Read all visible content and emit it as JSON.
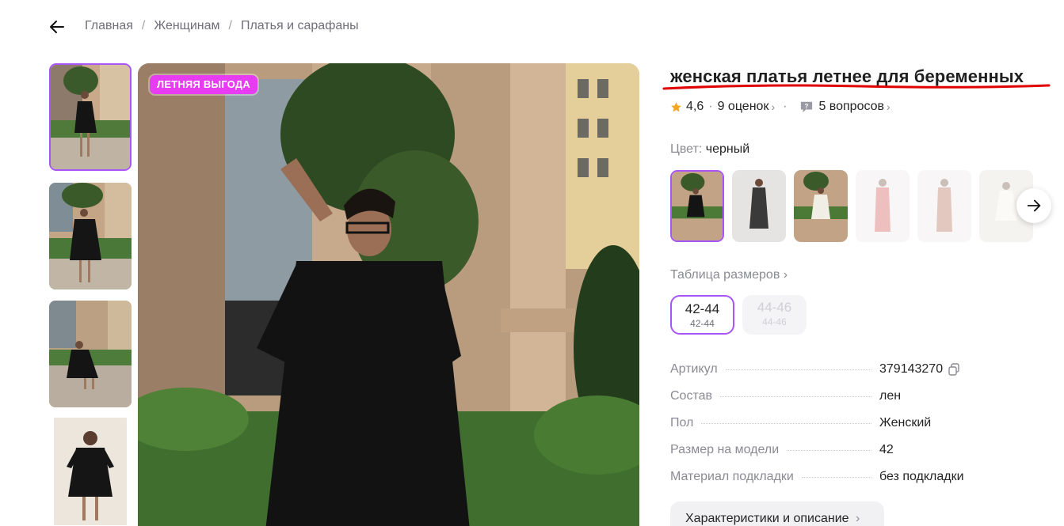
{
  "breadcrumb": {
    "items": [
      "Главная",
      "Женщинам",
      "Платья и сарафаны"
    ]
  },
  "gallery": {
    "promo_badge": "ЛЕТНЯЯ ВЫГОДА",
    "thumbnails_count": 4
  },
  "product": {
    "title": "женская платья летнее для беременных",
    "rating": "4,6",
    "reviews": "9 оценок",
    "questions": "5 вопросов",
    "color_label": "Цвет:",
    "color_value": "черный",
    "size_table_label": "Таблица размеров",
    "sizes": [
      {
        "label": "42-44",
        "sub": "42-44",
        "available": true,
        "selected": true
      },
      {
        "label": "44-46",
        "sub": "44-46",
        "available": false,
        "selected": false
      }
    ],
    "specs": [
      {
        "key": "Артикул",
        "value": "379143270"
      },
      {
        "key": "Состав",
        "value": "лен"
      },
      {
        "key": "Пол",
        "value": "Женский"
      },
      {
        "key": "Размер на модели",
        "value": "42"
      },
      {
        "key": "Материал подкладки",
        "value": "без подкладки"
      }
    ],
    "characteristics_button": "Характеристики и описание"
  },
  "colors": {
    "accent": "#a855f7",
    "promo": "#e83cf2",
    "underline": "#e00000",
    "star": "#f5a524"
  },
  "icons": {
    "back": "arrow-left-icon",
    "star": "star-icon",
    "question": "question-bubble-icon",
    "next": "arrow-right-icon",
    "copy": "copy-icon"
  }
}
